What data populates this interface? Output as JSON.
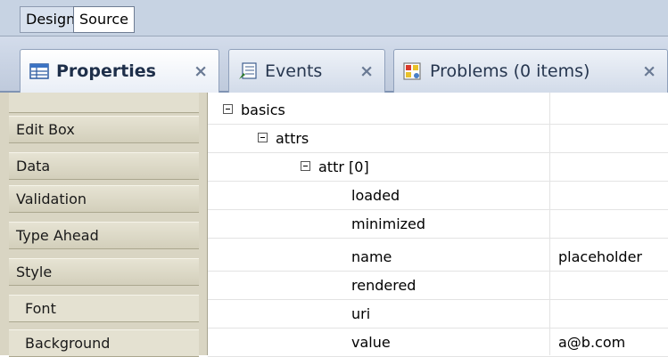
{
  "mode_tabs": {
    "design": "Design",
    "source": "Source"
  },
  "panel_tabs": [
    {
      "label": "Properties",
      "close": "×",
      "icon": "properties-icon"
    },
    {
      "label": "Events",
      "close": "×",
      "icon": "events-icon"
    },
    {
      "label": "Problems (0 items)",
      "close": "×",
      "icon": "problems-icon"
    }
  ],
  "sidebar": {
    "items": [
      "Edit Box",
      "Data",
      "Validation",
      "Type Ahead",
      "Style",
      "Font",
      "Background"
    ]
  },
  "tree": [
    {
      "label": "basics",
      "value": ""
    },
    {
      "label": "attrs",
      "value": ""
    },
    {
      "label": "attr [0]",
      "value": ""
    },
    {
      "label": "loaded",
      "value": ""
    },
    {
      "label": "minimized",
      "value": ""
    },
    {
      "label": "name",
      "value": "placeholder"
    },
    {
      "label": "rendered",
      "value": ""
    },
    {
      "label": "uri",
      "value": ""
    },
    {
      "label": "value",
      "value": "a@b.com"
    }
  ],
  "colors": {
    "tab_bar": "#c7d3e3",
    "sidebar": "#d9d5c3",
    "text": "#000000"
  }
}
